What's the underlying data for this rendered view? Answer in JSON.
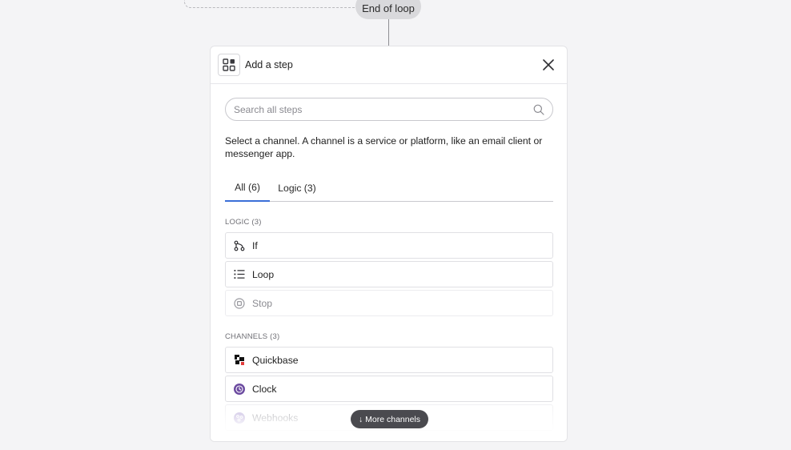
{
  "canvas": {
    "end_loop_label": "End of loop"
  },
  "panel": {
    "title": "Add a step",
    "search": {
      "placeholder": "Search all steps",
      "value": ""
    },
    "description": "Select a channel. A channel is a service or platform, like an email client or messenger app.",
    "tabs": [
      {
        "label": "All (6)",
        "active": true
      },
      {
        "label": "Logic (3)",
        "active": false
      }
    ],
    "logic_section": {
      "label": "LOGIC (3)",
      "items": [
        {
          "label": "If",
          "icon": "branch-icon",
          "enabled": true
        },
        {
          "label": "Loop",
          "icon": "list-icon",
          "enabled": true
        },
        {
          "label": "Stop",
          "icon": "stop-icon",
          "enabled": false
        }
      ]
    },
    "channels_section": {
      "label": "CHANNELS (3)",
      "items": [
        {
          "label": "Quickbase",
          "icon": "quickbase-logo-icon",
          "enabled": true
        },
        {
          "label": "Clock",
          "icon": "clock-icon",
          "enabled": true
        },
        {
          "label": "Webhooks",
          "icon": "webhooks-icon",
          "enabled": false
        }
      ]
    },
    "more_channels_label": "↓ More channels"
  },
  "colors": {
    "accent": "#3b6fd8",
    "clock_purple": "#6c4ba0",
    "webhooks_purple": "#b3a3d6",
    "more_button_bg": "#4a4a4f"
  }
}
